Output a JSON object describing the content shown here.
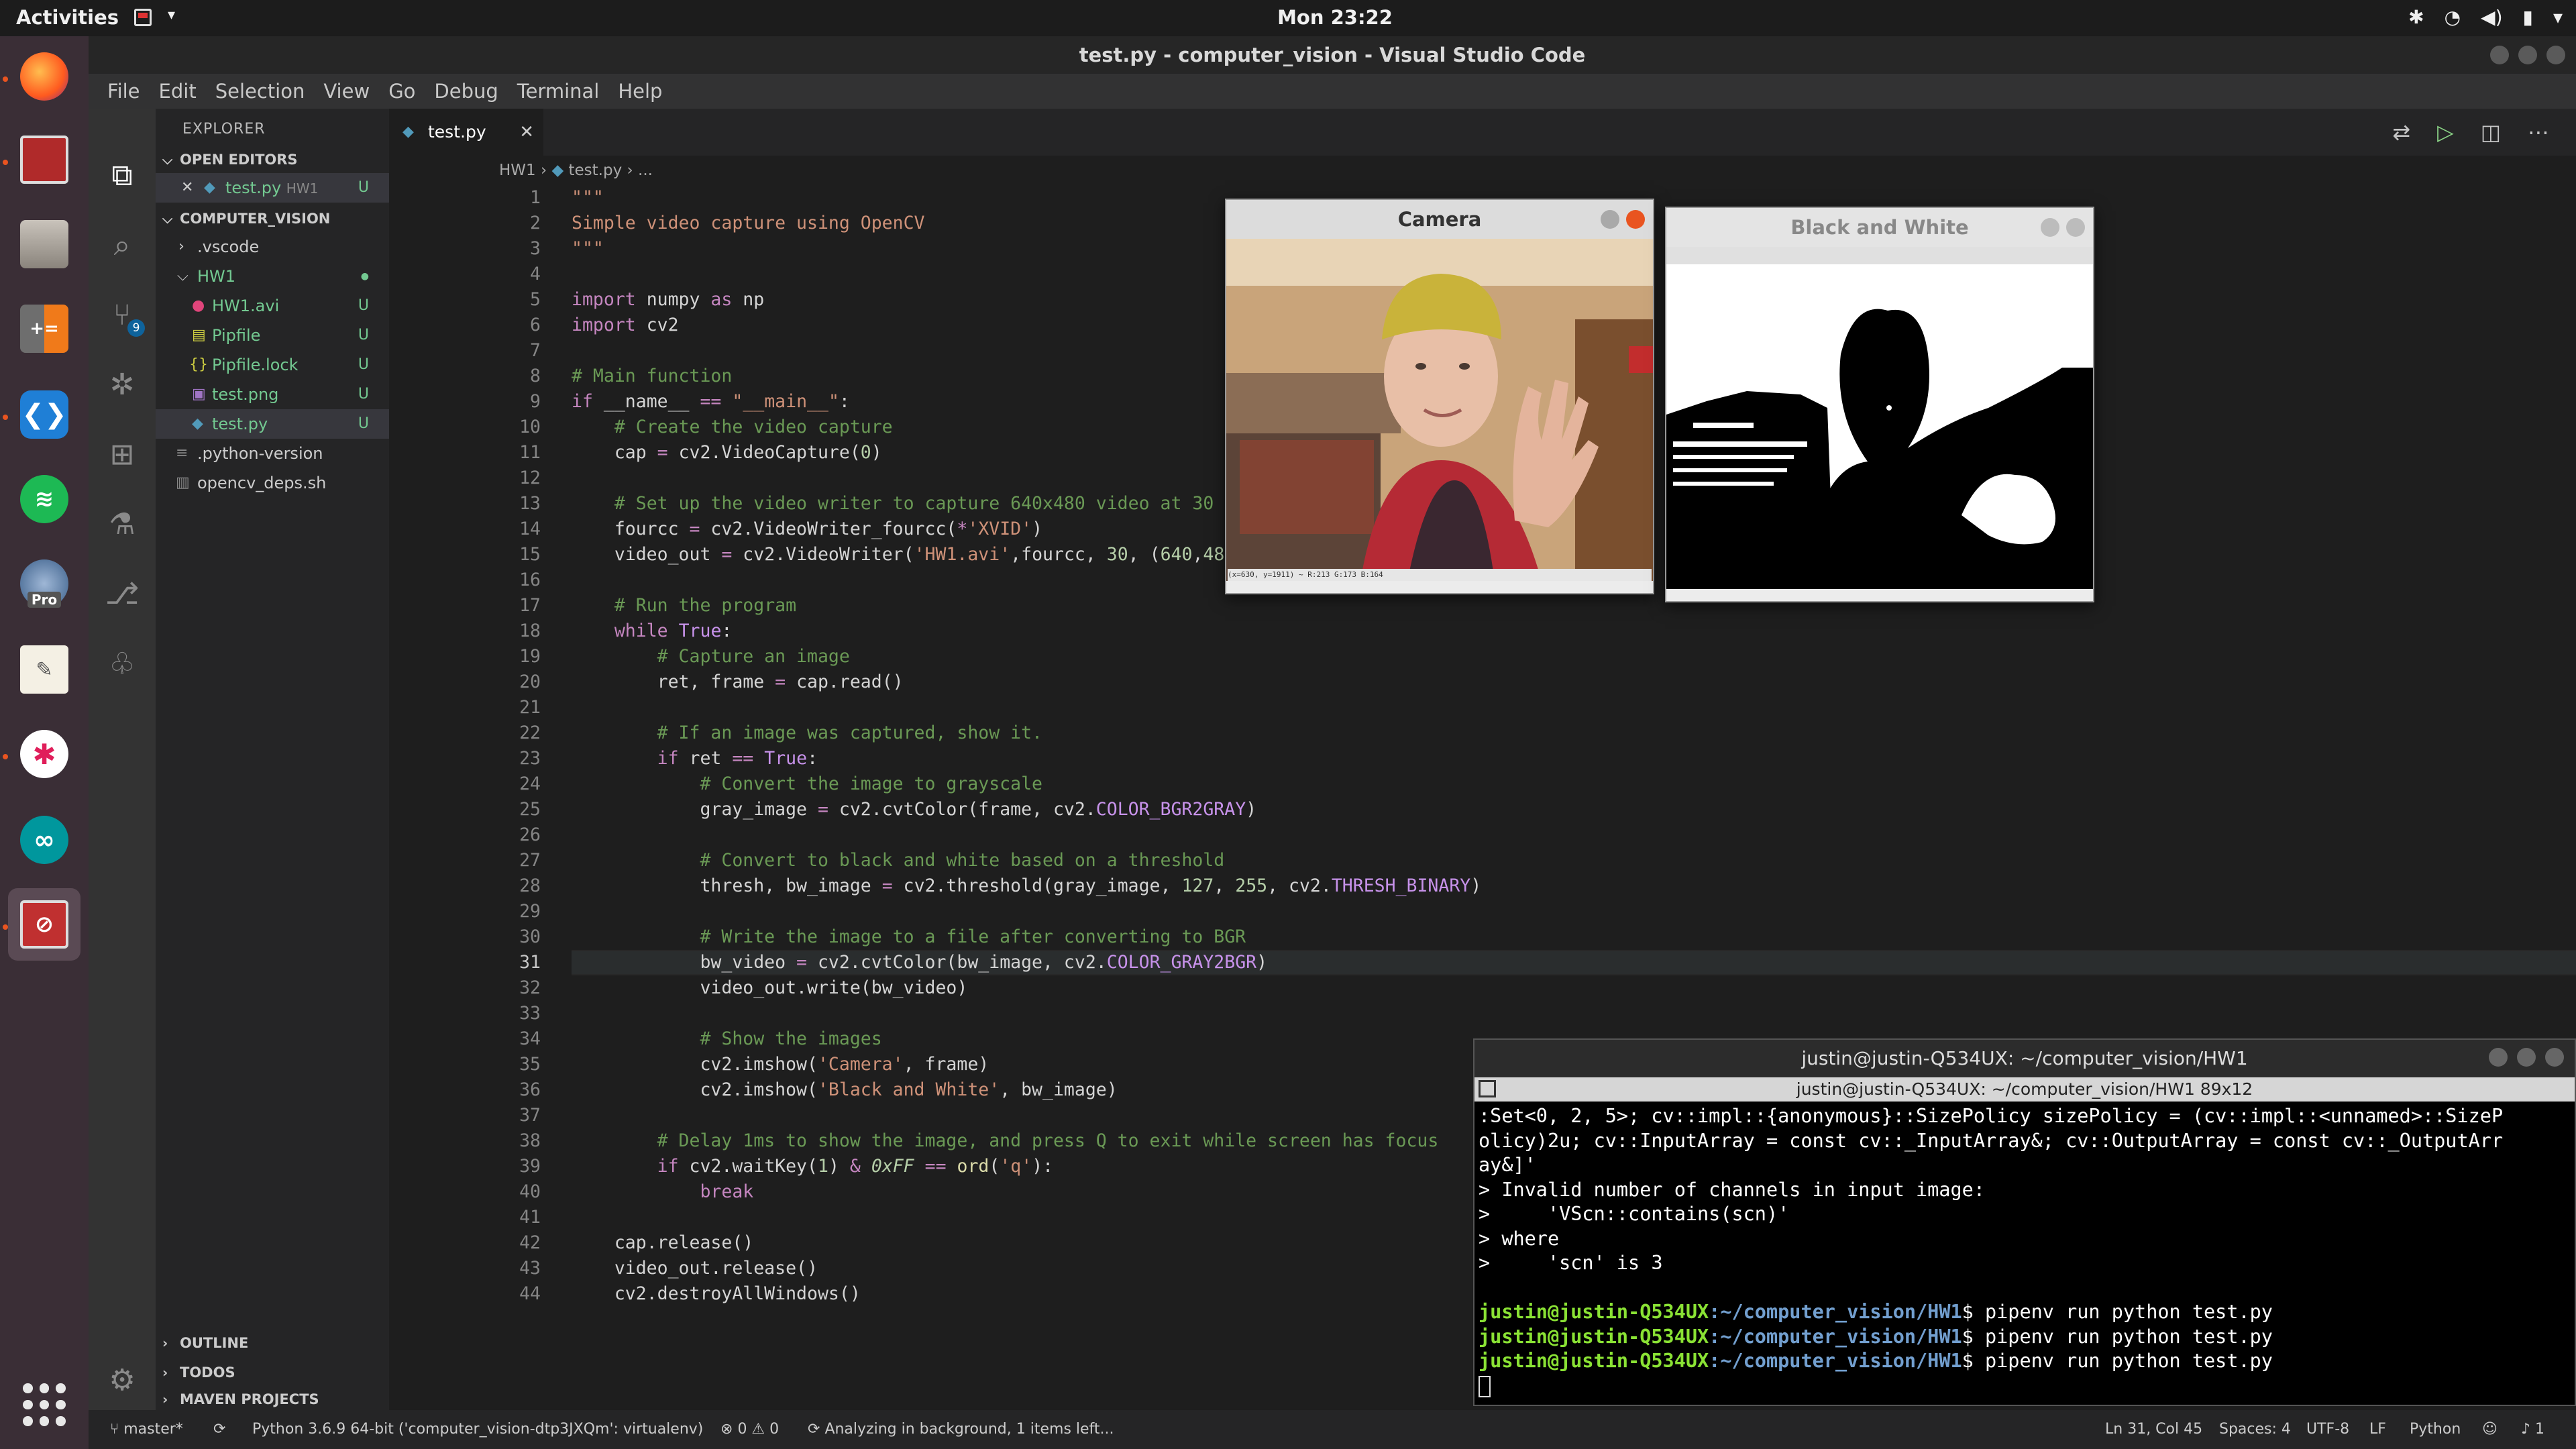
{
  "topbar": {
    "activities": "Activities",
    "clock": "Mon 23:22"
  },
  "dock": {
    "apps": [
      "firefox-icon",
      "terminal-app-icon",
      "files-icon",
      "calculator-icon",
      "vscode-icon",
      "spotify-icon",
      "google-earth-pro-icon",
      "text-editor-icon",
      "slack-icon",
      "arduino-icon",
      "camera-app-icon"
    ],
    "pro_label": "Pro"
  },
  "vscode": {
    "title": "test.py - computer_vision - Visual Studio Code",
    "menu": [
      "File",
      "Edit",
      "Selection",
      "View",
      "Go",
      "Debug",
      "Terminal",
      "Help"
    ],
    "scm_badge": "9",
    "explorer": {
      "header": "EXPLORER",
      "open_editors": "OPEN EDITORS",
      "open_file": "test.py",
      "open_file_folder": "HW1",
      "workspace": "COMPUTER_VISION",
      "outline": "OUTLINE",
      "todos": "TODOS",
      "maven": "MAVEN PROJECTS",
      "status_u": "U",
      "items": {
        "vscode": ".vscode",
        "hw1": "HW1",
        "hw1avi": "HW1.avi",
        "pipfile": "Pipfile",
        "pipfilelock": "Pipfile.lock",
        "testpng": "test.png",
        "testpy": "test.py",
        "pyver": ".python-version",
        "opencv": "opencv_deps.sh"
      }
    },
    "tab": {
      "label": "test.py"
    },
    "breadcrumb": {
      "folder": "HW1",
      "file": "test.py",
      "more": "..."
    },
    "status": {
      "branch": "master*",
      "python": "Python 3.6.9 64-bit ('computer_vision-dtp3JXQm': virtualenv)",
      "problems": "0",
      "warnings": "0",
      "analyzing": "Analyzing in background, 1 items left...",
      "position": "Ln 31, Col 45",
      "spaces": "Spaces: 4",
      "encoding": "UTF-8",
      "eol": "LF",
      "language": "Python",
      "notifications": "1"
    }
  },
  "camera_window": {
    "title": "Camera",
    "pixel_readout": "(x=630, y=1911) ~ R:213 G:173 B:164"
  },
  "bw_window": {
    "title": "Black and White"
  },
  "terminal": {
    "title": "justin@justin-Q534UX: ~/computer_vision/HW1",
    "tab_title": "justin@justin-Q534UX: ~/computer_vision/HW1 89x12",
    "lines": [
      ":Set<0, 2, 5>; cv::impl::{anonymous}::SizePolicy sizePolicy = (cv::impl::<unnamed>::SizeP",
      "olicy)2u; cv::InputArray = const cv::_InputArray&; cv::OutputArray = const cv::_OutputArr",
      "ay&]'",
      "> Invalid number of channels in input image:",
      ">     'VScn::contains(scn)'",
      "> where",
      ">     'scn' is 3",
      ""
    ],
    "prompt_user": "justin@justin-Q534UX",
    "prompt_path": ":~/computer_vision/HW1",
    "command": "$ pipenv run python test.py"
  }
}
